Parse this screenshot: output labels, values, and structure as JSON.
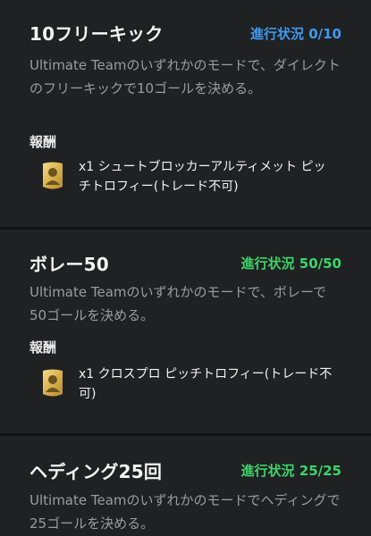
{
  "objectives": [
    {
      "title": "10フリーキック",
      "progress": "進行状況 0/10",
      "progress_color": "#3f9bf0",
      "description": "Ultimate Teamのいずれかのモードで、ダイレクトのフリーキックで10ゴールを決める。",
      "reward_heading": "報酬",
      "reward": "x1 シュートブロッカーアルティメット ピッチトロフィー(トレード不可)",
      "reward_icon": "gold-trophy-card-icon"
    },
    {
      "title": "ボレー50",
      "progress": "進行状況 50/50",
      "progress_color": "#3ed46a",
      "description": "Ultimate Teamのいずれかのモードで、ボレーで50ゴールを決める。",
      "reward_heading": "報酬",
      "reward": "x1 クロスプロ ピッチトロフィー(トレード不可)",
      "reward_icon": "gold-trophy-card-icon"
    },
    {
      "title": "ヘディング25回",
      "progress": "進行状況 25/25",
      "progress_color": "#3ed46a",
      "description": "Ultimate Teamのいずれかのモードでヘディングで25ゴールを決める。"
    }
  ]
}
